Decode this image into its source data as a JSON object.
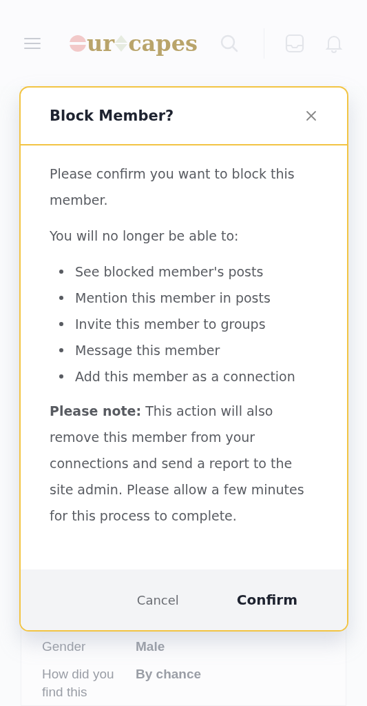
{
  "header": {
    "logo": {
      "parts": [
        "ur",
        "capes"
      ]
    }
  },
  "profile": {
    "rows": [
      {
        "label": "Gender",
        "value": "Male"
      },
      {
        "label": "How did you find this",
        "value": "By chance"
      }
    ]
  },
  "dialog": {
    "title": "Block Member?",
    "intro": "Please confirm you want to block this member.",
    "list_heading": "You will no longer be able to:",
    "items": [
      "See blocked member's posts",
      "Mention this member in posts",
      "Invite this member to groups",
      "Message this member",
      "Add this member as a connection"
    ],
    "note": "**Please note:** This action will also remove this member from your connections and send a report to the site admin. Please allow a few minutes for this process to complete.",
    "buttons": [
      {
        "label": "Cancel",
        "kind": "secondary"
      },
      {
        "label": "Confirm",
        "kind": "primary"
      }
    ]
  }
}
